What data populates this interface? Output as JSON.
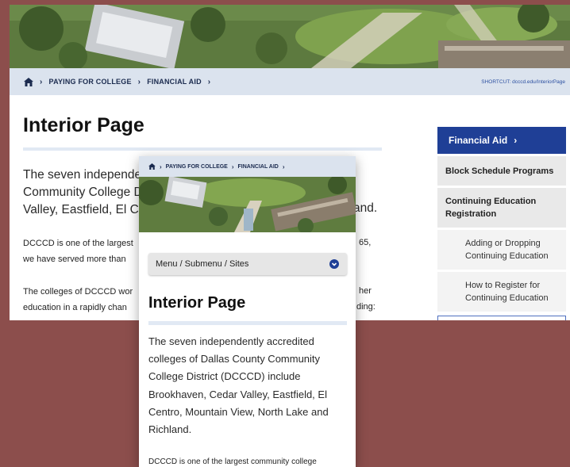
{
  "desktop": {
    "breadcrumb": [
      "PAYING FOR COLLEGE",
      "FINANCIAL AID"
    ],
    "shortcut_label": "SHORTCUT:",
    "shortcut_url": "dcccd.edu/InteriorPage",
    "title": "Interior Page",
    "intro_lines": [
      "The seven independer",
      "Community College Dis",
      "Valley, Eastfield, El Cen"
    ],
    "intro_end": "and.",
    "para1_lines": [
      "DCCCD is one of the largest",
      "we have served more than"
    ],
    "para1_tail": "65,",
    "para2_lines": [
      "The colleges of DCCCD wor",
      "education in a rapidly chan"
    ],
    "para2_tails": [
      "her",
      "ding:"
    ],
    "sidebar": {
      "header": "Financial Aid",
      "items": [
        "Block Schedule Programs",
        "Continuing Education Registration"
      ],
      "subitems": [
        "Adding or Dropping Continuing Education",
        "How to Register for Continuing Education"
      ]
    }
  },
  "mobile": {
    "breadcrumb": [
      "PAYING FOR COLLEGE",
      "FINANCIAL AID"
    ],
    "menu_label": "Menu / Submenu / Sites",
    "title": "Interior Page",
    "intro": "The seven independently accredited colleges of Dallas County Community College District (DCCCD) include Brookhaven, Cedar Valley, Eastfield, El Centro, Mountain View, North Lake and Richland.",
    "para_start": "DCCCD is one of the largest community college"
  },
  "icons": {
    "home": "home-icon",
    "chevron": "chevron-right-icon",
    "dropdown": "chevron-down-circle-icon"
  },
  "colors": {
    "background": "#8c4e4c",
    "brand_blue": "#1f3f96",
    "crumb_bg": "#dbe3ee"
  }
}
